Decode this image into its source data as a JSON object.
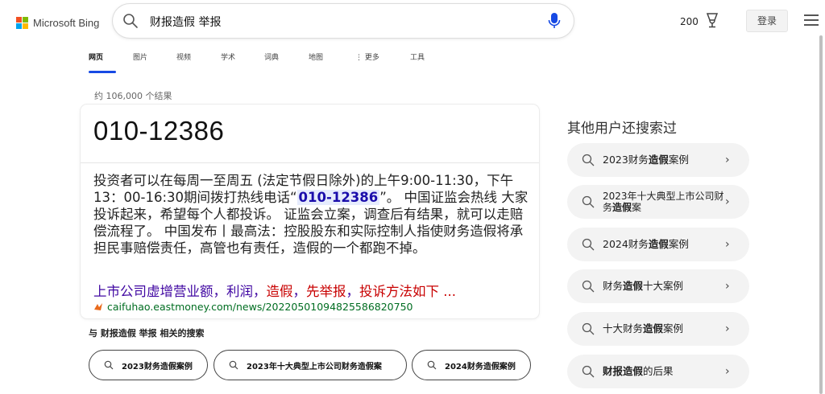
{
  "header": {
    "brand": "Microsoft Bing",
    "query": "财报造假 举报",
    "rewards_points": "200",
    "login_label": "登录"
  },
  "tabs": [
    {
      "label": "网页",
      "active": true
    },
    {
      "label": "图片"
    },
    {
      "label": "视频"
    },
    {
      "label": "学术"
    },
    {
      "label": "词典"
    },
    {
      "label": "地图"
    },
    {
      "label": "更多"
    },
    {
      "label": "工具"
    }
  ],
  "result_count": "约 106,000 个结果",
  "answer": {
    "number": "010-12386",
    "snippet_before": "投资者可以在每周一至周五 (法定节假日除外)的上午9:00-11:30，下午13：00-16:30期间拨打热线电话“",
    "snippet_highlight": "010-12386",
    "snippet_after": "”。 中国证监会热线 大家投诉起来，希望每个人都投诉。 证监会立案，调查后有结果，就可以走赔偿流程了。 中国发布丨最高法：控股股东和实际控制人指使财务造假将承担民事赔偿责任，高管也有责任，造假的一个都跑不掉。",
    "source_title_parts": [
      "上市公司虚增营业额，利润，",
      "造假",
      "，",
      "先举报",
      "，",
      "投诉方法如下 ..."
    ],
    "source_url": "caifuhao.eastmoney.com/news/20220501094825586820750"
  },
  "related": {
    "title": "与 财报造假 举报 相关的搜索",
    "pills": [
      "2023财务造假案例",
      "2023年十大典型上市公司财务造假案",
      "2024财务造假案例"
    ]
  },
  "sidebar": {
    "title": "其他用户还搜索过",
    "items": [
      {
        "pre": "2023财务",
        "bold": "造假",
        "post": "案例"
      },
      {
        "pre": "2023年十大典型上市公司财务",
        "bold": "造假",
        "post": "案"
      },
      {
        "pre": "2024财务",
        "bold": "造假",
        "post": "案例"
      },
      {
        "pre": "财务",
        "bold": "造假",
        "post": "十大案例"
      },
      {
        "pre": "十大财务",
        "bold": "造假",
        "post": "案例"
      },
      {
        "pre": "",
        "bold": "财报造假",
        "post": "的后果"
      }
    ]
  },
  "colors": {
    "accent": "#174ae4",
    "link": "#4007a2",
    "url": "#006d21",
    "highlight_red": "#c80000"
  }
}
